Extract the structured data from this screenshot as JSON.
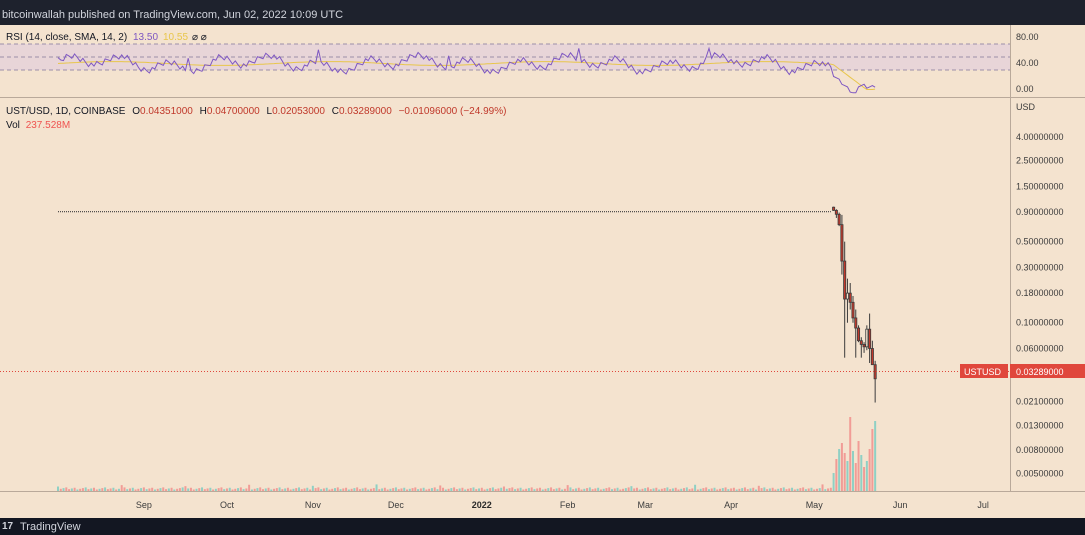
{
  "header": {
    "text": "bitcoinwallah published on TradingView.com, Jun 02, 2022 10:09 UTC"
  },
  "footer": {
    "logo": "17",
    "brand": "TradingView"
  },
  "rsi": {
    "label": "RSI (14, close, SMA, 14, 2)",
    "value": "13.50",
    "sma_value": "10.55",
    "extra": "⌀ ⌀",
    "ticks": [
      "80.00",
      "40.00",
      "0.00"
    ]
  },
  "ohlc": {
    "symbol": "UST/USD, 1D, COINBASE",
    "o_label": "O",
    "o": "0.04351000",
    "h_label": "H",
    "h": "0.04700000",
    "l_label": "L",
    "l": "0.02053000",
    "c_label": "C",
    "c": "0.03289000",
    "change": "−0.01096000 (−24.99%)",
    "vol_label": "Vol",
    "vol": "237.528M"
  },
  "price_axis": {
    "currency": "USD",
    "ticks": [
      "4.00000000",
      "2.50000000",
      "1.50000000",
      "0.90000000",
      "0.50000000",
      "0.30000000",
      "0.18000000",
      "0.10000000",
      "0.06000000",
      "0.02100000",
      "0.01300000",
      "0.00800000",
      "0.00500000"
    ]
  },
  "price_label": {
    "symbol": "USTUSD",
    "value": "0.03289000"
  },
  "time_axis": {
    "ticks": [
      "Sep",
      "Oct",
      "Nov",
      "Dec",
      "2022",
      "Feb",
      "Mar",
      "Apr",
      "May",
      "Jun",
      "Jul"
    ]
  },
  "colors": {
    "up": "#26a69a",
    "down": "#ef5350",
    "bg": "#f4e3cf",
    "rsi": "#7e57c2",
    "rsi_sma": "#e8c64a",
    "price_tag": "#e0473c"
  },
  "chart_data": {
    "type": "candlestick",
    "title": "UST/USD, 1D, COINBASE",
    "scale": "log",
    "ylim": [
      0.004,
      5
    ],
    "series": [
      {
        "date": "2021-08-01",
        "close": 1.0
      },
      {
        "date": "2022-05-07",
        "close": 1.0
      },
      {
        "date": "2022-05-08",
        "open": 0.99,
        "high": 1.0,
        "low": 0.92,
        "close": 0.93
      },
      {
        "date": "2022-05-09",
        "open": 0.93,
        "high": 0.95,
        "low": 0.8,
        "close": 0.86
      },
      {
        "date": "2022-05-10",
        "open": 0.86,
        "high": 0.89,
        "low": 0.68,
        "close": 0.7
      },
      {
        "date": "2022-05-11",
        "open": 0.7,
        "high": 0.85,
        "low": 0.26,
        "close": 0.34
      },
      {
        "date": "2022-05-12",
        "open": 0.34,
        "high": 0.5,
        "low": 0.05,
        "close": 0.16
      },
      {
        "date": "2022-05-13",
        "open": 0.16,
        "high": 0.24,
        "low": 0.1,
        "close": 0.18
      },
      {
        "date": "2022-05-14",
        "open": 0.18,
        "high": 0.22,
        "low": 0.13,
        "close": 0.15
      },
      {
        "date": "2022-05-15",
        "open": 0.15,
        "high": 0.17,
        "low": 0.1,
        "close": 0.11
      },
      {
        "date": "2022-05-16",
        "open": 0.11,
        "high": 0.13,
        "low": 0.05,
        "close": 0.09
      },
      {
        "date": "2022-05-17",
        "open": 0.09,
        "high": 0.095,
        "low": 0.068,
        "close": 0.07
      },
      {
        "date": "2022-05-18",
        "open": 0.07,
        "high": 0.075,
        "low": 0.05,
        "close": 0.065
      },
      {
        "date": "2022-05-19",
        "open": 0.065,
        "high": 0.068,
        "low": 0.055,
        "close": 0.062
      },
      {
        "date": "2022-05-20",
        "open": 0.062,
        "high": 0.095,
        "low": 0.058,
        "close": 0.088
      },
      {
        "date": "2022-05-21",
        "open": 0.088,
        "high": 0.12,
        "low": 0.045,
        "close": 0.06
      },
      {
        "date": "2022-05-22",
        "open": 0.06,
        "high": 0.07,
        "low": 0.045,
        "close": 0.04351
      },
      {
        "date": "2022-05-23",
        "open": 0.04351,
        "high": 0.047,
        "low": 0.02053,
        "close": 0.03289
      }
    ],
    "volume_last": "237.528M",
    "rsi_last": 13.5,
    "rsi_sma_last": 10.55
  }
}
